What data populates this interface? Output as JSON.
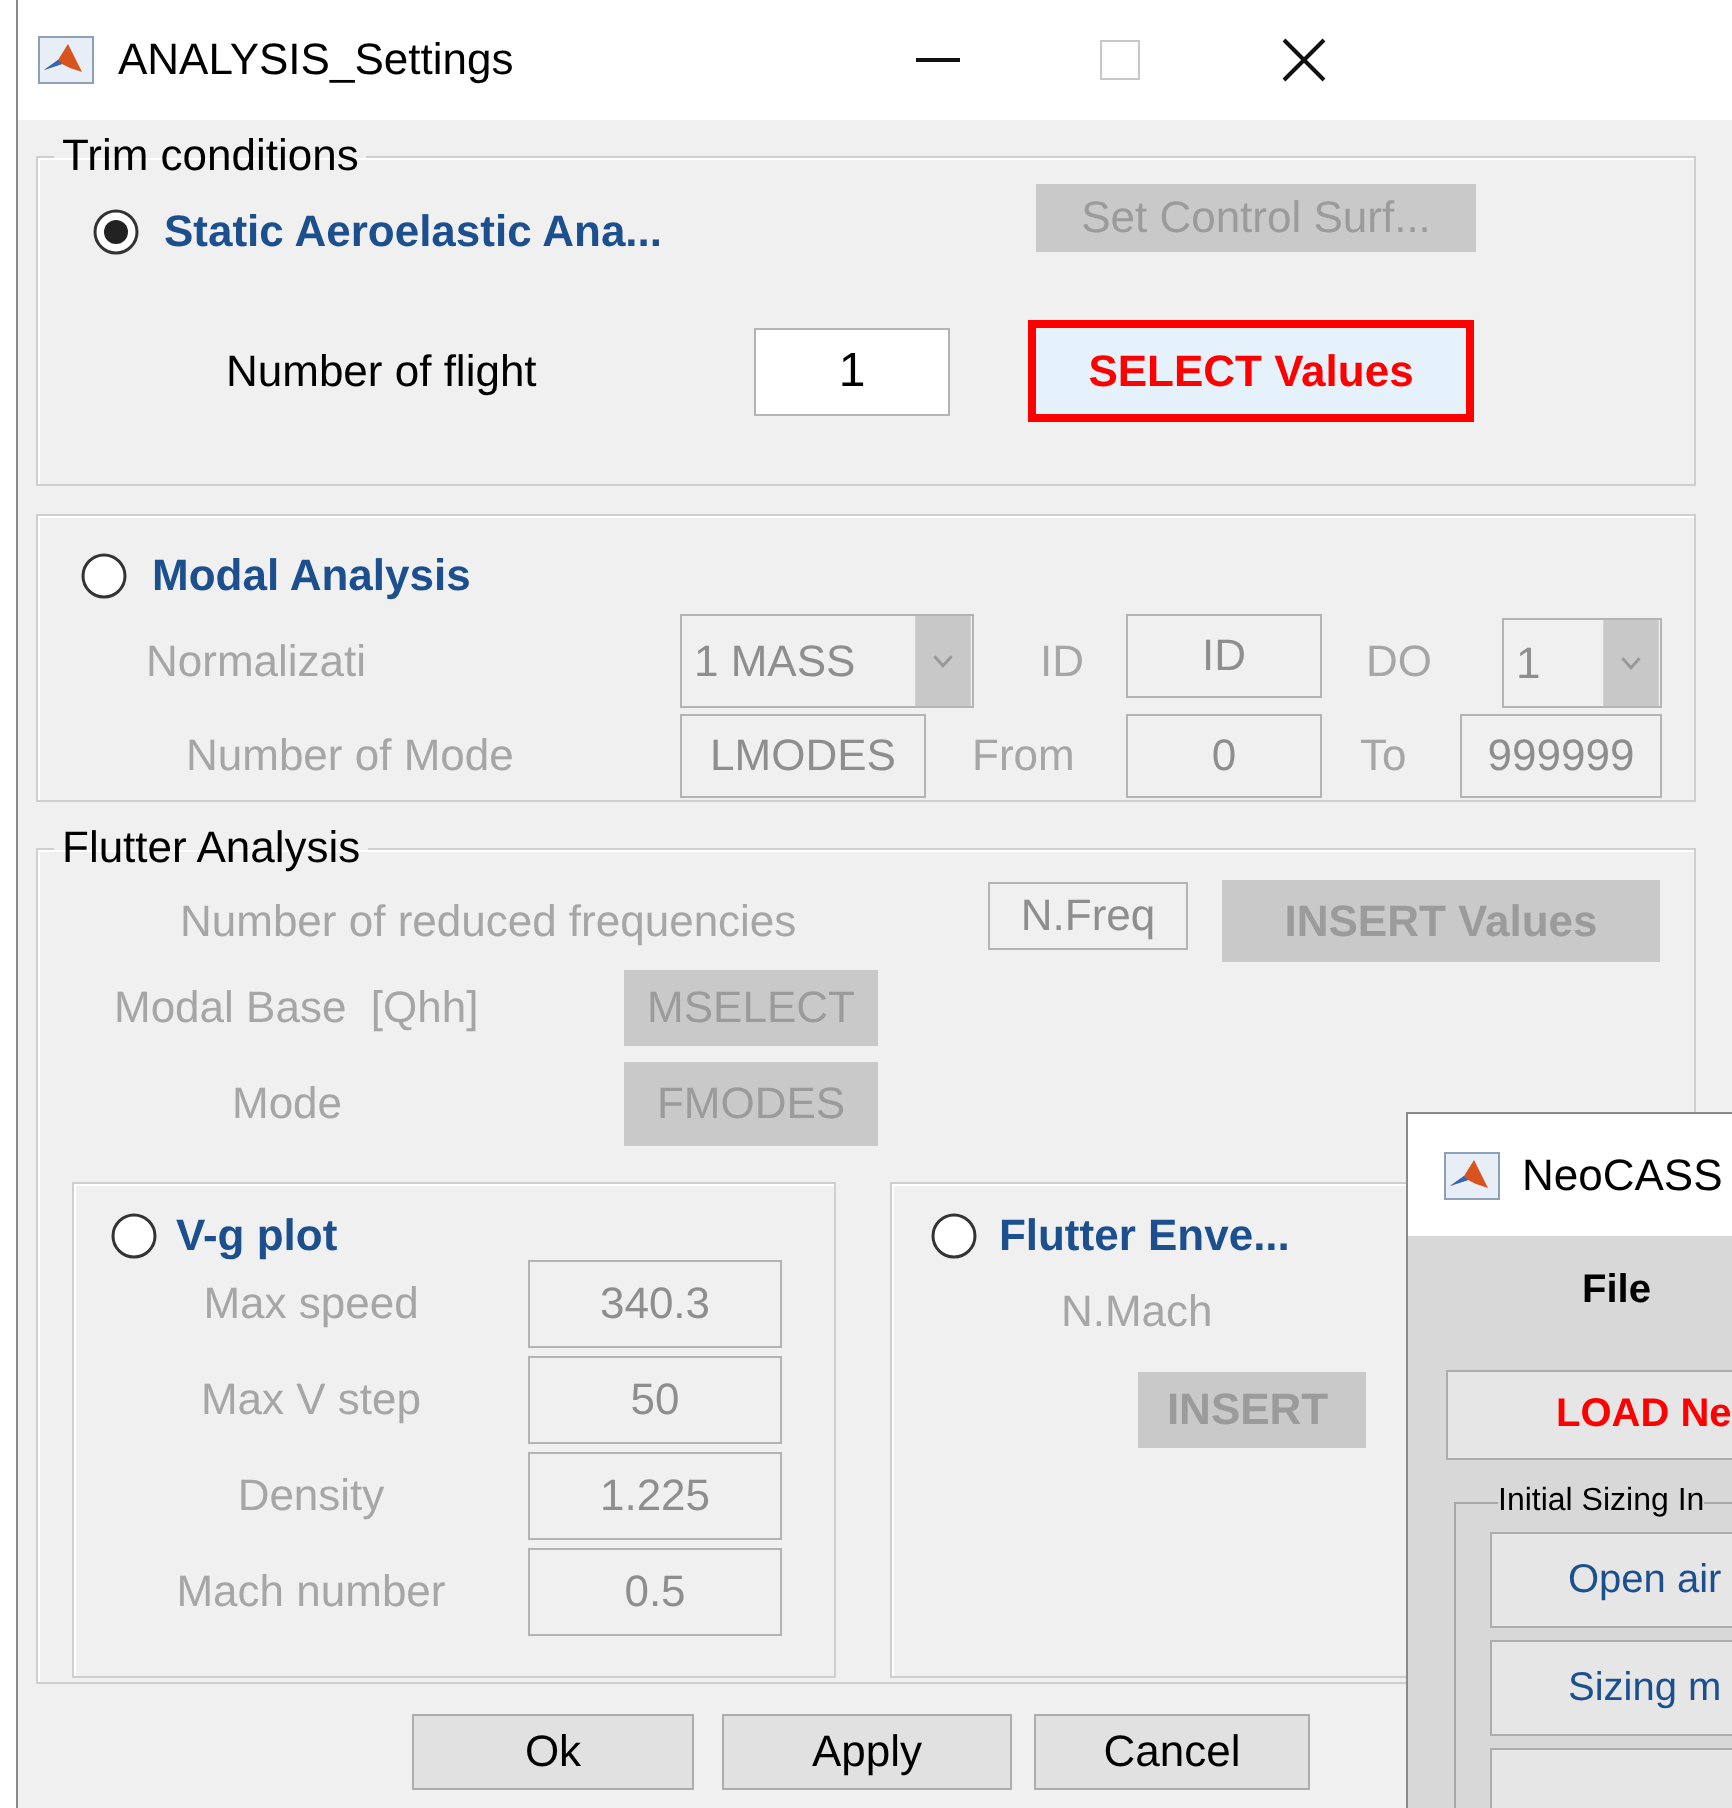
{
  "window": {
    "title": "ANALYSIS_Settings"
  },
  "trim": {
    "legend": "Trim conditions",
    "option": {
      "label": "Static Aeroelastic Ana...",
      "selected": true
    },
    "control_surface_button": {
      "label": "Set Control Surf...",
      "disabled": true
    },
    "flight_count": {
      "label": "Number of flight",
      "value": "1"
    },
    "select_button": {
      "label": "SELECT Values",
      "highlighted": true
    }
  },
  "modal": {
    "option": {
      "label": "Modal Analysis",
      "selected": false
    },
    "normalization": {
      "label": "Normalizati",
      "value": "1 MASS"
    },
    "id": {
      "label": "ID",
      "value": "ID"
    },
    "do": {
      "label": "DO",
      "value": "1"
    },
    "modes": {
      "label": "Number of Mode",
      "value": "LMODES"
    },
    "from": {
      "label": "From",
      "value": "0"
    },
    "to": {
      "label": "To",
      "value": "999999"
    }
  },
  "flutter": {
    "legend": "Flutter Analysis",
    "reduced_frequencies": {
      "label": "Number of reduced frequencies",
      "value": "N.Freq"
    },
    "insert_button": {
      "label": "INSERT Values",
      "disabled": true
    },
    "modal_base": {
      "label": "Modal Base  [Qhh]",
      "button": "MSELECT",
      "disabled": true
    },
    "mode": {
      "label": "Mode",
      "button": "FMODES",
      "disabled": true
    },
    "vg_plot": {
      "option": {
        "label": "V-g plot",
        "selected": false
      },
      "fields": [
        {
          "label": "Max speed",
          "value": "340.3"
        },
        {
          "label": "Max V step",
          "value": "50"
        },
        {
          "label": "Density",
          "value": "1.225"
        },
        {
          "label": "Mach number",
          "value": "0.5"
        }
      ]
    },
    "envelope": {
      "option": {
        "label": "Flutter Enve...",
        "selected": false
      },
      "mach_label": "N.Mach",
      "insert_button": {
        "label": "INSERT",
        "disabled": true
      }
    }
  },
  "buttons": [
    "Ok",
    "Apply",
    "Cancel"
  ],
  "neocass": {
    "title": "NeoCASS",
    "menu": "File",
    "load_button": "LOAD Ne",
    "group_legend": "Initial Sizing In",
    "buttons": [
      "Open air",
      "Sizing m"
    ]
  }
}
